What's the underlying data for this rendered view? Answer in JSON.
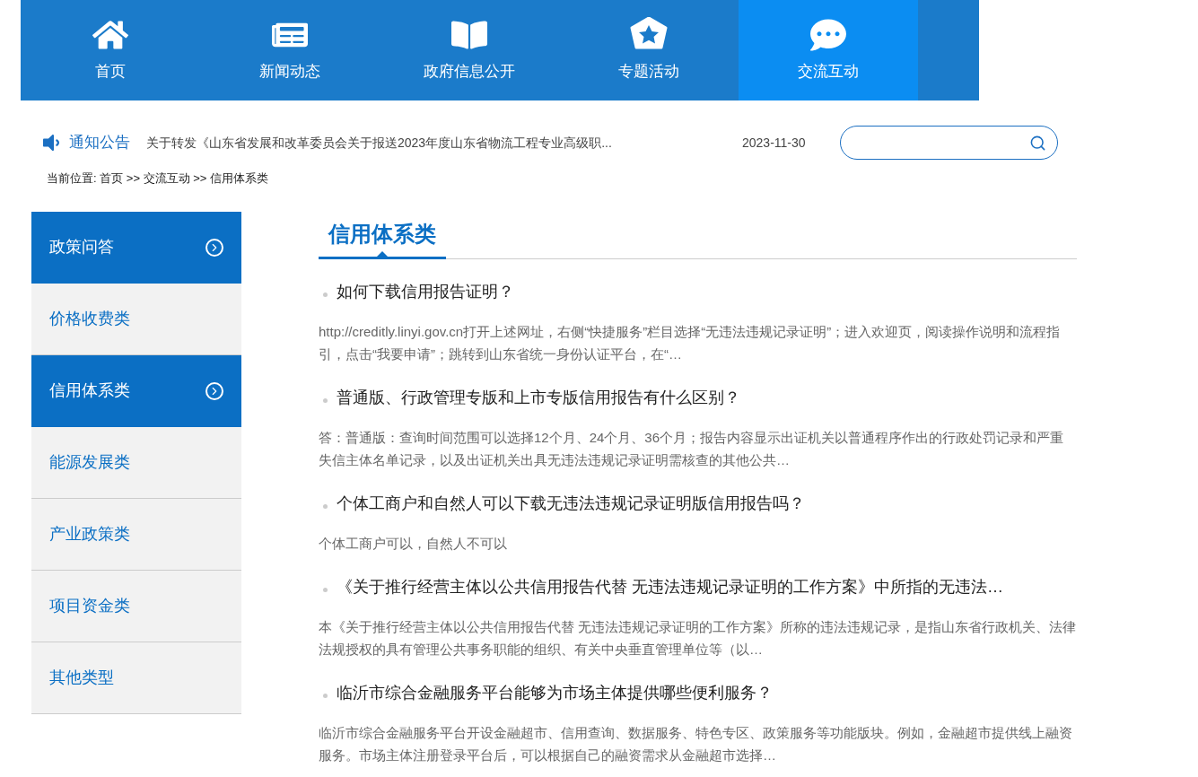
{
  "nav": [
    {
      "label": "首页",
      "selected": false
    },
    {
      "label": "新闻动态",
      "selected": false
    },
    {
      "label": "政府信息公开",
      "selected": false
    },
    {
      "label": "专题活动",
      "selected": false
    },
    {
      "label": "交流互动",
      "selected": true
    }
  ],
  "notice": {
    "label": "通知公告",
    "title": "关于转发《山东省发展和改革委员会关于报送2023年度山东省物流工程专业高级职...",
    "date": "2023-11-30"
  },
  "breadcrumb": "当前位置: 首页 >> 交流互动 >> 信用体系类",
  "sidebar": {
    "items": [
      {
        "label": "政策问答",
        "selected": true
      },
      {
        "label": "价格收费类",
        "selected": false
      },
      {
        "label": "信用体系类",
        "selected": true
      },
      {
        "label": "能源发展类",
        "selected": false
      },
      {
        "label": "产业政策类",
        "selected": false
      },
      {
        "label": "项目资金类",
        "selected": false
      },
      {
        "label": "其他类型",
        "selected": false
      }
    ]
  },
  "content": {
    "title": "信用体系类",
    "items": [
      {
        "question": "如何下载信用报告证明？",
        "answer": "http://creditly.linyi.gov.cn打开上述网址，右侧“快捷服务”栏目选择“无违法违规记录证明”；进入欢迎页，阅读操作说明和流程指引，点击“我要申请”；跳转到山东省统一身份认证平台，在“…"
      },
      {
        "question": "普通版、行政管理专版和上市专版信用报告有什么区别？",
        "answer": "答：普通版：查询时间范围可以选择12个月、24个月、36个月；报告内容显示出证机关以普通程序作出的行政处罚记录和严重失信主体名单记录，以及出证机关出具无违法违规记录证明需核查的其他公共…"
      },
      {
        "question": "个体工商户和自然人可以下载无违法违规记录证明版信用报告吗？",
        "answer": "个体工商户可以，自然人不可以"
      },
      {
        "question": "《关于推行经营主体以公共信用报告代替 无违法违规记录证明的工作方案》中所指的无违法…",
        "answer": "本《关于推行经营主体以公共信用报告代替 无违法违规记录证明的工作方案》所称的违法违规记录，是指山东省行政机关、法律法规授权的具有管理公共事务职能的组织、有关中央垂直管理单位等（以…"
      },
      {
        "question": "临沂市综合金融服务平台能够为市场主体提供哪些便利服务？",
        "answer": "临沂市综合金融服务平台开设金融超市、信用查询、数据服务、特色专区、政策服务等功能版块。例如，金融超市提供线上融资服务。市场主体注册登录平台后，可以根据自己的融资需求从金融超市选择…"
      }
    ]
  }
}
